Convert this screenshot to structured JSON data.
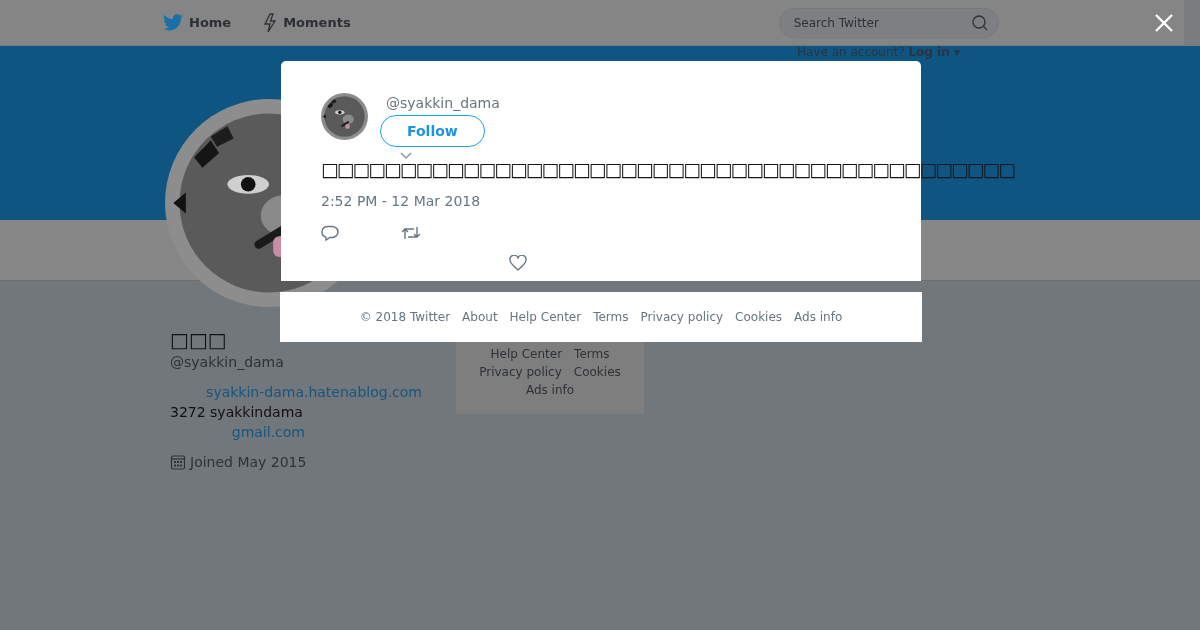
{
  "header": {
    "nav": [
      {
        "label": "Home",
        "kind": "home"
      },
      {
        "label": "Moments",
        "kind": "moments"
      }
    ],
    "search": {
      "placeholder": "Search Twitter"
    },
    "login_prompt": {
      "text": "Have an account?",
      "link": "Log in",
      "caret": "▾"
    }
  },
  "profile": {
    "name": "□□□",
    "handle": "@syakkin_dama",
    "bio": [
      {
        "text": "syakkin-dama.hatenablog.com",
        "kind": "link"
      },
      {
        "text": "3272 syakkindama",
        "kind": "plain"
      },
      {
        "text": "gmail.com",
        "kind": "link"
      }
    ],
    "joined": "Joined May 2015"
  },
  "side_footer": [
    [
      "Help Center",
      "Terms"
    ],
    [
      "Privacy policy",
      "Cookies"
    ],
    [
      "Ads info"
    ]
  ],
  "tweet": {
    "handle": "@syakkin_dama",
    "follow_button": "Follow",
    "text": "□□□□□□□□□□□□□□□□□□□□□□□□□□□□□□□□□□□□□□□□□□□□",
    "timestamp": "2:52 PM - 12 Mar 2018"
  },
  "modal_footer": [
    "© 2018 Twitter",
    "About",
    "Help Center",
    "Terms",
    "Privacy policy",
    "Cookies",
    "Ads info"
  ]
}
